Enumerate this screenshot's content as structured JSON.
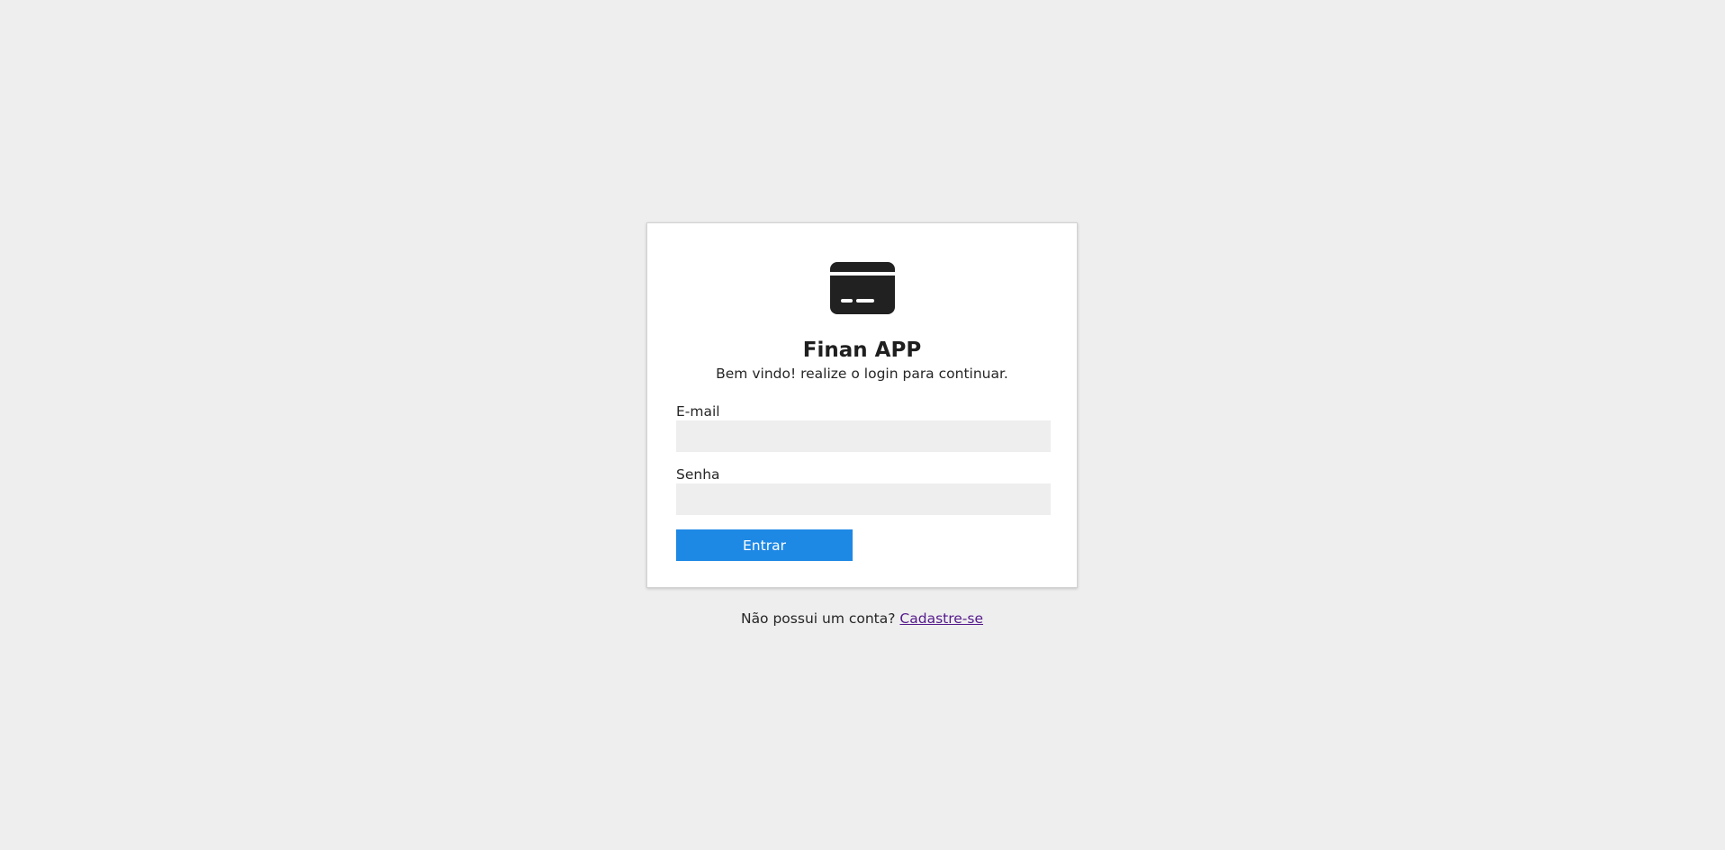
{
  "app": {
    "logo_icon": "credit-card-icon",
    "title": "Finan APP",
    "subtitle": "Bem vindo! realize o login para continuar."
  },
  "form": {
    "email_label": "E-mail",
    "email_value": "",
    "password_label": "Senha",
    "password_value": "",
    "submit_label": "Entrar"
  },
  "footer": {
    "prompt": "Não possui um conta?",
    "signup_link": "Cadastre-se"
  },
  "colors": {
    "background": "#eeeeee",
    "card": "#ffffff",
    "primary_button": "#1e88e5",
    "link_visited": "#551a8b",
    "input_background": "#eeeeee"
  }
}
